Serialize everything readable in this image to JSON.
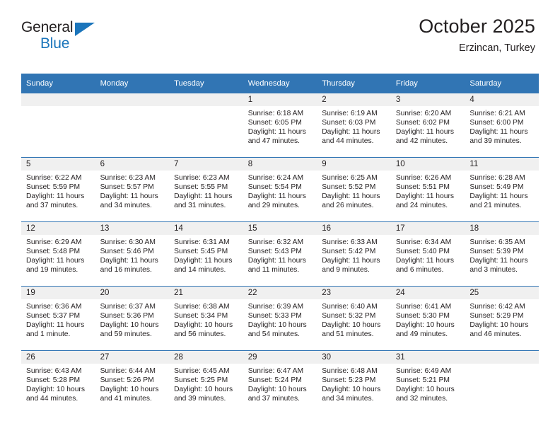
{
  "brand": {
    "name_top": "General",
    "name_bottom": "Blue",
    "triangle_icon": "blue-triangle-icon",
    "color_dark": "#231f20",
    "color_blue": "#1b75bb"
  },
  "header": {
    "title": "October 2025",
    "subtitle": "Erzincan, Turkey"
  },
  "theme": {
    "header_row_bg": "#3175b4",
    "daynum_band_bg": "#f0f0f0",
    "grid_line": "#3175b4",
    "text": "#231f20"
  },
  "calendar": {
    "weekday_headers": [
      "Sunday",
      "Monday",
      "Tuesday",
      "Wednesday",
      "Thursday",
      "Friday",
      "Saturday"
    ],
    "weeks": [
      [
        {
          "day": "",
          "lines": []
        },
        {
          "day": "",
          "lines": []
        },
        {
          "day": "",
          "lines": []
        },
        {
          "day": "1",
          "lines": [
            "Sunrise: 6:18 AM",
            "Sunset: 6:05 PM",
            "Daylight: 11 hours",
            "and 47 minutes."
          ]
        },
        {
          "day": "2",
          "lines": [
            "Sunrise: 6:19 AM",
            "Sunset: 6:03 PM",
            "Daylight: 11 hours",
            "and 44 minutes."
          ]
        },
        {
          "day": "3",
          "lines": [
            "Sunrise: 6:20 AM",
            "Sunset: 6:02 PM",
            "Daylight: 11 hours",
            "and 42 minutes."
          ]
        },
        {
          "day": "4",
          "lines": [
            "Sunrise: 6:21 AM",
            "Sunset: 6:00 PM",
            "Daylight: 11 hours",
            "and 39 minutes."
          ]
        }
      ],
      [
        {
          "day": "5",
          "lines": [
            "Sunrise: 6:22 AM",
            "Sunset: 5:59 PM",
            "Daylight: 11 hours",
            "and 37 minutes."
          ]
        },
        {
          "day": "6",
          "lines": [
            "Sunrise: 6:23 AM",
            "Sunset: 5:57 PM",
            "Daylight: 11 hours",
            "and 34 minutes."
          ]
        },
        {
          "day": "7",
          "lines": [
            "Sunrise: 6:23 AM",
            "Sunset: 5:55 PM",
            "Daylight: 11 hours",
            "and 31 minutes."
          ]
        },
        {
          "day": "8",
          "lines": [
            "Sunrise: 6:24 AM",
            "Sunset: 5:54 PM",
            "Daylight: 11 hours",
            "and 29 minutes."
          ]
        },
        {
          "day": "9",
          "lines": [
            "Sunrise: 6:25 AM",
            "Sunset: 5:52 PM",
            "Daylight: 11 hours",
            "and 26 minutes."
          ]
        },
        {
          "day": "10",
          "lines": [
            "Sunrise: 6:26 AM",
            "Sunset: 5:51 PM",
            "Daylight: 11 hours",
            "and 24 minutes."
          ]
        },
        {
          "day": "11",
          "lines": [
            "Sunrise: 6:28 AM",
            "Sunset: 5:49 PM",
            "Daylight: 11 hours",
            "and 21 minutes."
          ]
        }
      ],
      [
        {
          "day": "12",
          "lines": [
            "Sunrise: 6:29 AM",
            "Sunset: 5:48 PM",
            "Daylight: 11 hours",
            "and 19 minutes."
          ]
        },
        {
          "day": "13",
          "lines": [
            "Sunrise: 6:30 AM",
            "Sunset: 5:46 PM",
            "Daylight: 11 hours",
            "and 16 minutes."
          ]
        },
        {
          "day": "14",
          "lines": [
            "Sunrise: 6:31 AM",
            "Sunset: 5:45 PM",
            "Daylight: 11 hours",
            "and 14 minutes."
          ]
        },
        {
          "day": "15",
          "lines": [
            "Sunrise: 6:32 AM",
            "Sunset: 5:43 PM",
            "Daylight: 11 hours",
            "and 11 minutes."
          ]
        },
        {
          "day": "16",
          "lines": [
            "Sunrise: 6:33 AM",
            "Sunset: 5:42 PM",
            "Daylight: 11 hours",
            "and 9 minutes."
          ]
        },
        {
          "day": "17",
          "lines": [
            "Sunrise: 6:34 AM",
            "Sunset: 5:40 PM",
            "Daylight: 11 hours",
            "and 6 minutes."
          ]
        },
        {
          "day": "18",
          "lines": [
            "Sunrise: 6:35 AM",
            "Sunset: 5:39 PM",
            "Daylight: 11 hours",
            "and 3 minutes."
          ]
        }
      ],
      [
        {
          "day": "19",
          "lines": [
            "Sunrise: 6:36 AM",
            "Sunset: 5:37 PM",
            "Daylight: 11 hours",
            "and 1 minute."
          ]
        },
        {
          "day": "20",
          "lines": [
            "Sunrise: 6:37 AM",
            "Sunset: 5:36 PM",
            "Daylight: 10 hours",
            "and 59 minutes."
          ]
        },
        {
          "day": "21",
          "lines": [
            "Sunrise: 6:38 AM",
            "Sunset: 5:34 PM",
            "Daylight: 10 hours",
            "and 56 minutes."
          ]
        },
        {
          "day": "22",
          "lines": [
            "Sunrise: 6:39 AM",
            "Sunset: 5:33 PM",
            "Daylight: 10 hours",
            "and 54 minutes."
          ]
        },
        {
          "day": "23",
          "lines": [
            "Sunrise: 6:40 AM",
            "Sunset: 5:32 PM",
            "Daylight: 10 hours",
            "and 51 minutes."
          ]
        },
        {
          "day": "24",
          "lines": [
            "Sunrise: 6:41 AM",
            "Sunset: 5:30 PM",
            "Daylight: 10 hours",
            "and 49 minutes."
          ]
        },
        {
          "day": "25",
          "lines": [
            "Sunrise: 6:42 AM",
            "Sunset: 5:29 PM",
            "Daylight: 10 hours",
            "and 46 minutes."
          ]
        }
      ],
      [
        {
          "day": "26",
          "lines": [
            "Sunrise: 6:43 AM",
            "Sunset: 5:28 PM",
            "Daylight: 10 hours",
            "and 44 minutes."
          ]
        },
        {
          "day": "27",
          "lines": [
            "Sunrise: 6:44 AM",
            "Sunset: 5:26 PM",
            "Daylight: 10 hours",
            "and 41 minutes."
          ]
        },
        {
          "day": "28",
          "lines": [
            "Sunrise: 6:45 AM",
            "Sunset: 5:25 PM",
            "Daylight: 10 hours",
            "and 39 minutes."
          ]
        },
        {
          "day": "29",
          "lines": [
            "Sunrise: 6:47 AM",
            "Sunset: 5:24 PM",
            "Daylight: 10 hours",
            "and 37 minutes."
          ]
        },
        {
          "day": "30",
          "lines": [
            "Sunrise: 6:48 AM",
            "Sunset: 5:23 PM",
            "Daylight: 10 hours",
            "and 34 minutes."
          ]
        },
        {
          "day": "31",
          "lines": [
            "Sunrise: 6:49 AM",
            "Sunset: 5:21 PM",
            "Daylight: 10 hours",
            "and 32 minutes."
          ]
        },
        {
          "day": "",
          "lines": []
        }
      ]
    ]
  }
}
